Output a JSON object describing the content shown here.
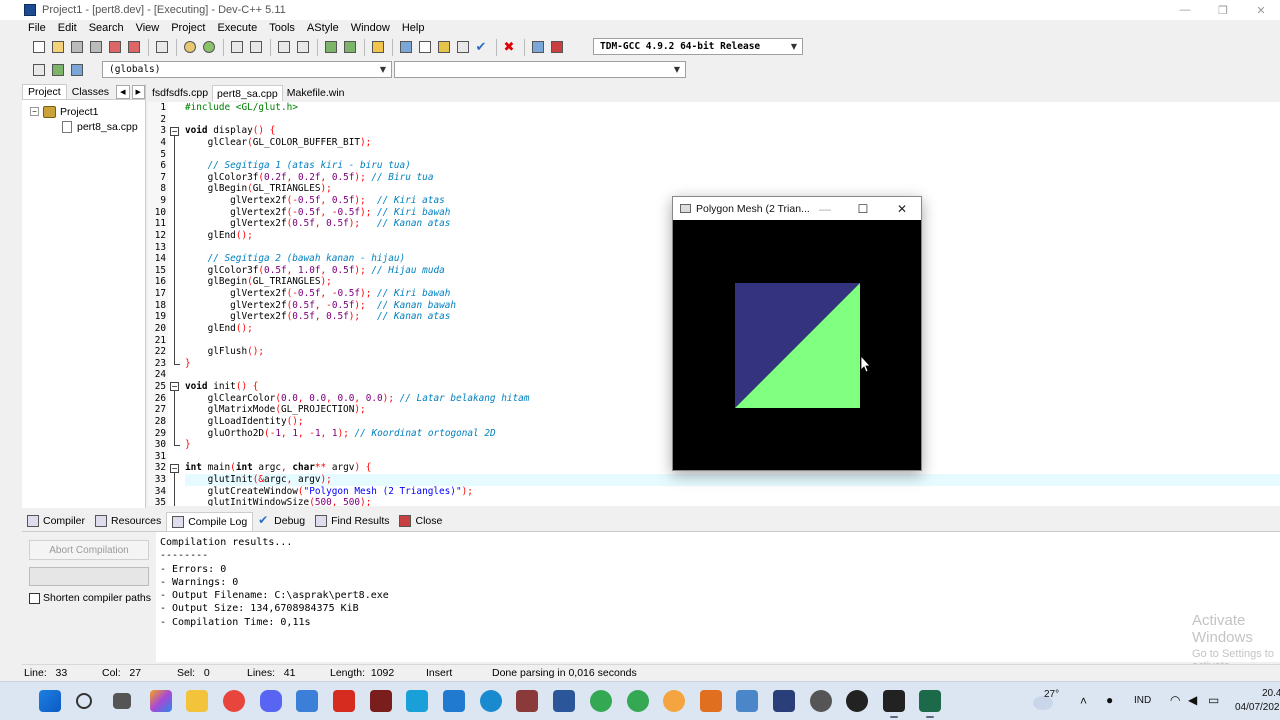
{
  "window": {
    "title": "Project1 - [pert8.dev] - [Executing] - Dev-C++ 5.11",
    "minimize_glyph": "—",
    "maximize_glyph": "❐",
    "close_glyph": "✕"
  },
  "menu": [
    "File",
    "Edit",
    "Search",
    "View",
    "Project",
    "Execute",
    "Tools",
    "AStyle",
    "Window",
    "Help"
  ],
  "toolbar": {
    "compiler_select": "TDM-GCC 4.9.2 64-bit Release",
    "scope_select": "(globals)",
    "member_select": ""
  },
  "left_panel": {
    "tabs": [
      "Project",
      "Classes"
    ],
    "prev_glyph": "◀",
    "next_glyph": "▶",
    "project_name": "Project1",
    "file_name": "pert8_sa.cpp",
    "expand_glyph": "−"
  },
  "editor_tabs": [
    "fsdfsdfs.cpp",
    "pert8_sa.cpp",
    "Makefile.win"
  ],
  "editor": {
    "line_numbers": [
      "1",
      "2",
      "3",
      "4",
      "5",
      "6",
      "7",
      "8",
      "9",
      "10",
      "11",
      "12",
      "13",
      "14",
      "15",
      "16",
      "17",
      "18",
      "19",
      "20",
      "21",
      "22",
      "23",
      "24",
      "25",
      "26",
      "27",
      "28",
      "29",
      "30",
      "31",
      "32",
      "33",
      "34",
      "35"
    ],
    "lines": [
      "#include <GL/glut.h>",
      "",
      "void display() {",
      "    glClear(GL_COLOR_BUFFER_BIT);",
      "",
      "    // Segitiga 1 (atas kiri - biru tua)",
      "    glColor3f(0.2f, 0.2f, 0.5f); // Biru tua",
      "    glBegin(GL_TRIANGLES);",
      "        glVertex2f(-0.5f, 0.5f);  // Kiri atas",
      "        glVertex2f(-0.5f, -0.5f); // Kiri bawah",
      "        glVertex2f(0.5f, 0.5f);   // Kanan atas",
      "    glEnd();",
      "",
      "    // Segitiga 2 (bawah kanan - hijau)",
      "    glColor3f(0.5f, 1.0f, 0.5f); // Hijau muda",
      "    glBegin(GL_TRIANGLES);",
      "        glVertex2f(-0.5f, -0.5f); // Kiri bawah",
      "        glVertex2f(0.5f, -0.5f);  // Kanan bawah",
      "        glVertex2f(0.5f, 0.5f);   // Kanan atas",
      "    glEnd();",
      "",
      "    glFlush();",
      "}",
      "",
      "void init() {",
      "    glClearColor(0.0, 0.0, 0.0, 0.0); // Latar belakang hitam",
      "    glMatrixMode(GL_PROJECTION);",
      "    glLoadIdentity();",
      "    gluOrtho2D(-1, 1, -1, 1); // Koordinat ortogonal 2D",
      "}",
      "",
      "int main(int argc, char** argv) {",
      "    glutInit(&argc, argv);",
      "    glutCreateWindow(\"Polygon Mesh (2 Triangles)\");",
      "    glutInitWindowSize(500, 500);"
    ],
    "highlight_line": 33
  },
  "gl_window": {
    "title": "Polygon Mesh (2 Trian...",
    "minimize_glyph": "—",
    "maximize_glyph": "☐",
    "close_glyph": "✕",
    "triangle1_color": "#333380",
    "triangle2_color": "#80ff80",
    "background_color": "#000000"
  },
  "bottom_tabs": [
    "Compiler",
    "Resources",
    "Compile Log",
    "Debug",
    "Find Results",
    "Close"
  ],
  "bottom": {
    "abort_label": "Abort Compilation",
    "shorten_label": "Shorten compiler paths",
    "log": [
      "Compilation results...",
      "--------",
      "- Errors: 0",
      "- Warnings: 0",
      "- Output Filename: C:\\asprak\\pert8.exe",
      "- Output Size: 134,6708984375 KiB",
      "- Compilation Time: 0,11s"
    ],
    "activate_title": "Activate Windows",
    "activate_sub": "Go to Settings to activate Windows."
  },
  "status": {
    "line": "Line:   33",
    "col": "Col:   27",
    "sel": "Sel:   0",
    "lines": "Lines:   41",
    "length": "Length:  1092",
    "mode": "Insert",
    "message": "Done parsing in 0,016 seconds"
  },
  "taskbar": {
    "temperature": "27°",
    "language": "IND",
    "time": "20.4",
    "date": "04/07/202"
  }
}
